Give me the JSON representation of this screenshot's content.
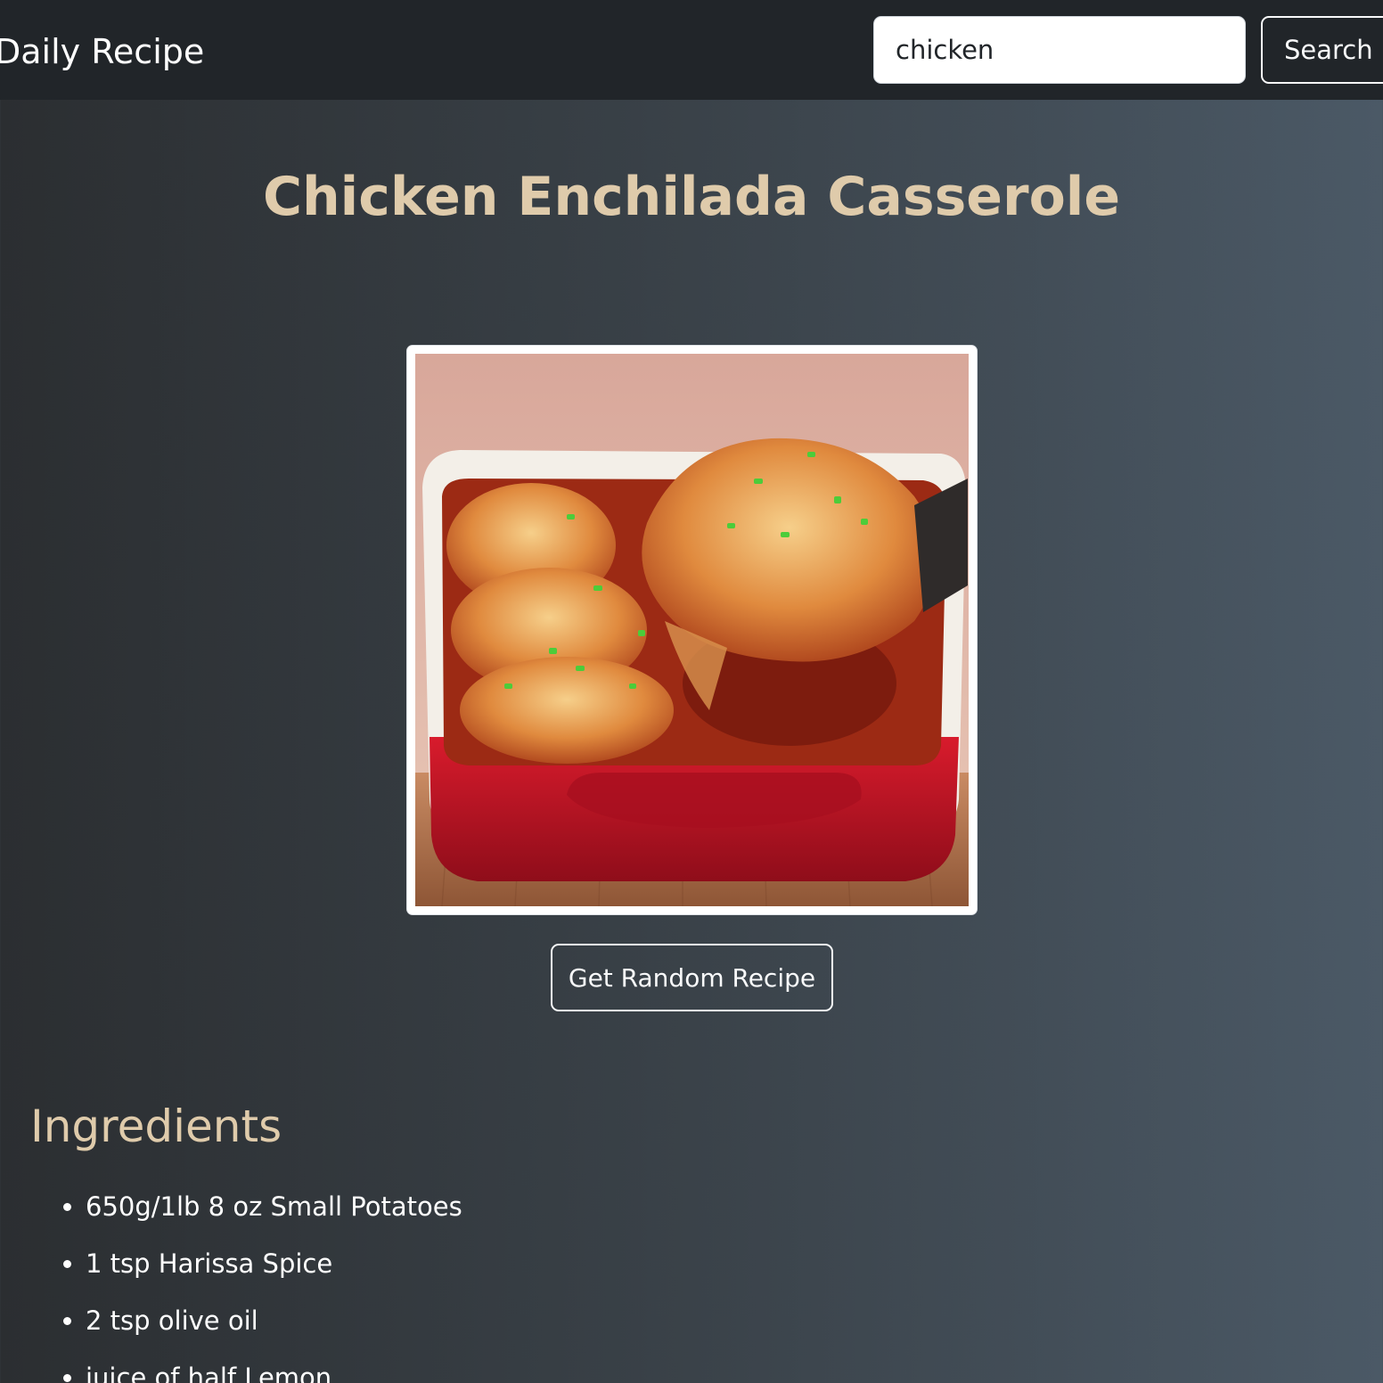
{
  "navbar": {
    "brand": "Daily Recipe",
    "search_value": "chicken",
    "search_button": "Search"
  },
  "recipe": {
    "title": "Chicken Enchilada Casserole",
    "image_alt": "Chicken Enchilada Casserole",
    "random_button": "Get Random Recipe",
    "ingredients_heading": "Ingredients",
    "ingredients": [
      "650g/1lb 8 oz Small Potatoes",
      "1 tsp Harissa Spice",
      "2 tsp olive oil",
      "juice of half Lemon"
    ]
  },
  "colors": {
    "navbar": "#212529",
    "accent_text": "#dfcbab",
    "dish_red": "#c8102e"
  }
}
